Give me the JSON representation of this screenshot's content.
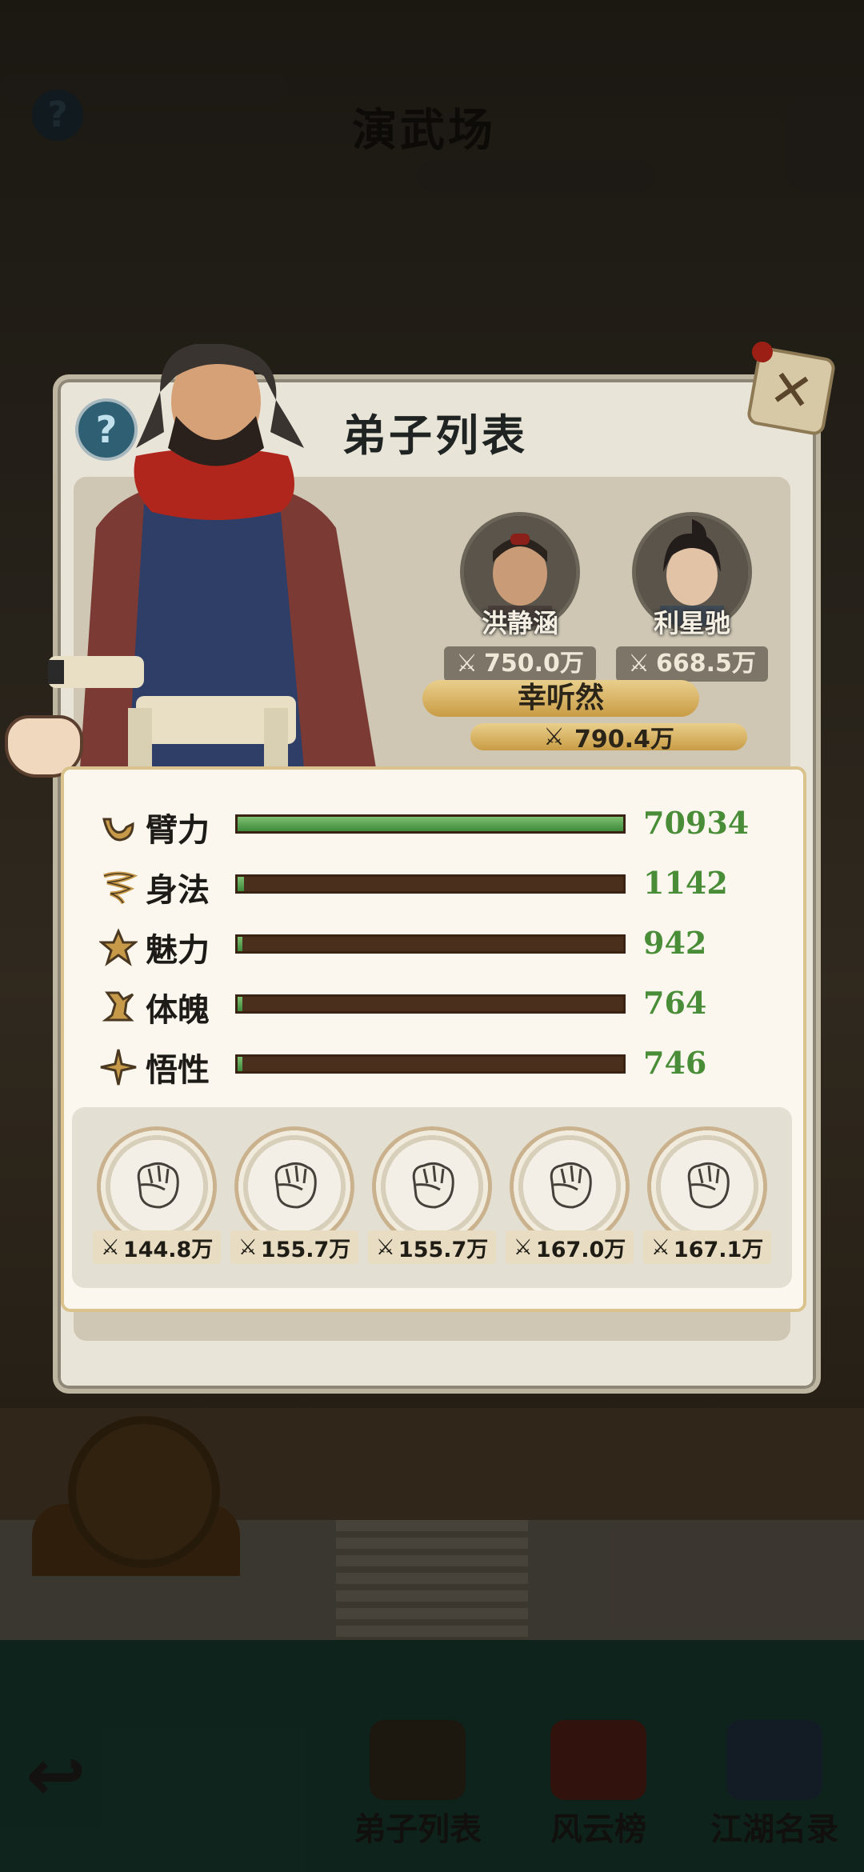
{
  "screen": {
    "title": "演武场",
    "help": "?",
    "nav": [
      {
        "label": "弟子列表",
        "icon": "disciple-icon"
      },
      {
        "label": "风云榜",
        "icon": "scroll-icon"
      },
      {
        "label": "江湖名录",
        "icon": "book-icon"
      }
    ]
  },
  "modal": {
    "title": "弟子列表",
    "help": "?",
    "close": "✕",
    "disciples": [
      {
        "name": "洪静涵",
        "power": "750.0万"
      },
      {
        "name": "利星驰",
        "power": "668.5万"
      }
    ],
    "selected": {
      "name": "幸听然",
      "power": "790.4万"
    },
    "stats": [
      {
        "label": "臂力",
        "value": "70934",
        "fill": 1.0,
        "icon": "arm-icon"
      },
      {
        "label": "身法",
        "value": "1142",
        "fill": 0.016,
        "icon": "whirlwind-icon"
      },
      {
        "label": "魅力",
        "value": "942",
        "fill": 0.013,
        "icon": "charm-star-icon"
      },
      {
        "label": "体魄",
        "value": "764",
        "fill": 0.011,
        "icon": "body-icon"
      },
      {
        "label": "悟性",
        "value": "746",
        "fill": 0.011,
        "icon": "insight-star-icon"
      }
    ],
    "skills": [
      {
        "power": "144.8万",
        "icon": "fist-icon"
      },
      {
        "power": "155.7万",
        "icon": "fist-icon"
      },
      {
        "power": "155.7万",
        "icon": "fist-icon"
      },
      {
        "power": "167.0万",
        "icon": "fist-icon"
      },
      {
        "power": "167.1万",
        "icon": "fist-icon"
      }
    ]
  }
}
